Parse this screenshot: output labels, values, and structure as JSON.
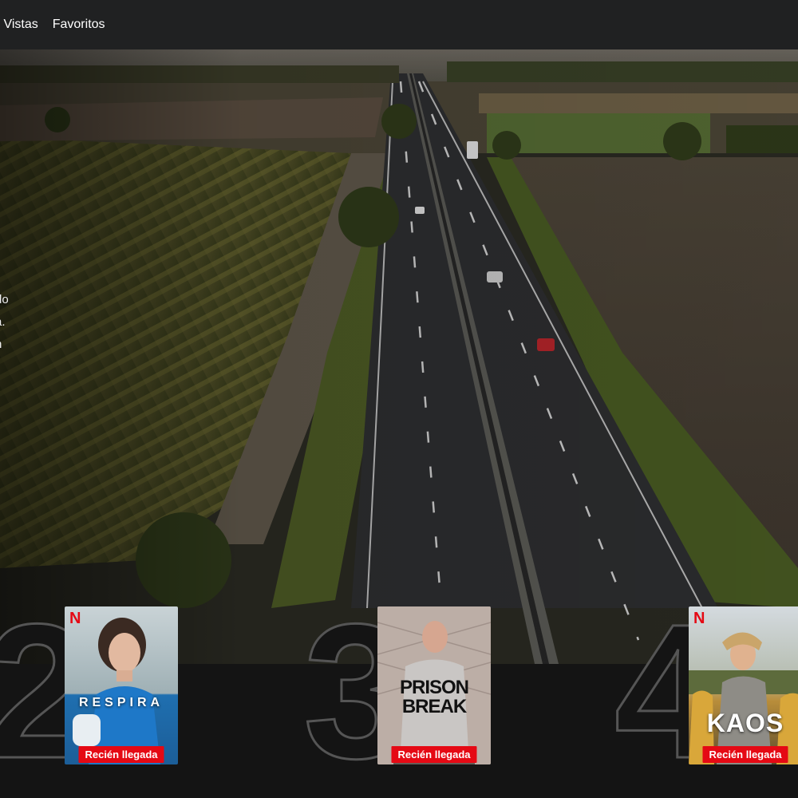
{
  "nav": {
    "items": [
      {
        "label": "s Vistas"
      },
      {
        "label": "Favoritos"
      }
    ]
  },
  "hero": {
    "description_lines": [
      "do",
      "a.",
      "n"
    ]
  },
  "top10": [
    {
      "rank": "2",
      "title": "RESPIRA",
      "badge": "Recién llegada",
      "brand": "N"
    },
    {
      "rank": "3",
      "title_line1": "PRISON",
      "title_line2": "BREAK",
      "badge": "Recién llegada"
    },
    {
      "rank": "4",
      "title": "KAOS",
      "badge": "Recién llegada",
      "brand": "N"
    }
  ],
  "colors": {
    "netflix_red": "#e50914",
    "topbar_bg": "#202122",
    "page_bg": "#141414"
  }
}
